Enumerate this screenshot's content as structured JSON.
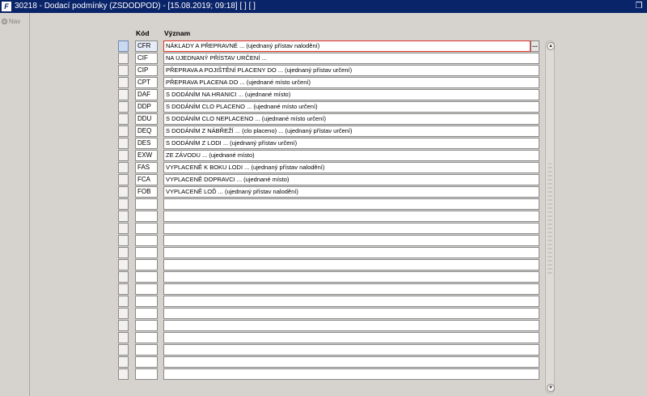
{
  "window": {
    "title": "30218 - Dodací podmínky (ZSDODPOD) - [15.08.2019; 09:18]  [ ]  [ ]",
    "app_icon_text": "F"
  },
  "nav": {
    "label": "Nav"
  },
  "table": {
    "headers": {
      "kod": "Kód",
      "vyznam": "Význam"
    },
    "rows": [
      {
        "kod": "CFR",
        "vyznam": "NÁKLADY A PŘEPRAVNÉ ... (ujednaný přístav nalodění)"
      },
      {
        "kod": "CIF",
        "vyznam": "NA UJEDNANÝ PŘÍSTAV URČENÍ ..."
      },
      {
        "kod": "CIP",
        "vyznam": "PŘEPRAVA A POJIŠTĚNÍ PLACENY DO ... (ujednaný přístav určení)"
      },
      {
        "kod": "CPT",
        "vyznam": "PŘEPRAVA PLACENA DO ... (ujednané místo určení)"
      },
      {
        "kod": "DAF",
        "vyznam": "S DODÁNÍM NA HRANICI ... (ujednané místo)"
      },
      {
        "kod": "DDP",
        "vyznam": "S DODÁNÍM CLO PLACENO ... (ujednané místo určení)"
      },
      {
        "kod": "DDU",
        "vyznam": "S DODÁNÍM CLO NEPLACENO ... (ujednané místo určení)"
      },
      {
        "kod": "DEQ",
        "vyznam": "S DODÁNÍM Z NÁBŘEŽÍ ... (clo placeno) ... (ujednaný přístav určení)"
      },
      {
        "kod": "DES",
        "vyznam": "S DODÁNÍM Z LODI ... (ujednaný přístav určení)"
      },
      {
        "kod": "EXW",
        "vyznam": "ZE ZÁVODU ... (ujednané místo)"
      },
      {
        "kod": "FAS",
        "vyznam": "VYPLACENĚ K BOKU LODI ... (ujednaný přístav nalodění)"
      },
      {
        "kod": "FCA",
        "vyznam": "VYPLACENĚ DOPRAVCI ... (ujednané místo)"
      },
      {
        "kod": "FOB",
        "vyznam": "VYPLACENĚ LOĎ ... (ujednaný přístav nalodění)"
      }
    ],
    "total_rows": 28,
    "ellipsis_label": "..."
  },
  "scrollbar": {
    "up_icon": "▲",
    "down_icon": "▼"
  },
  "restore_icon": "❐"
}
